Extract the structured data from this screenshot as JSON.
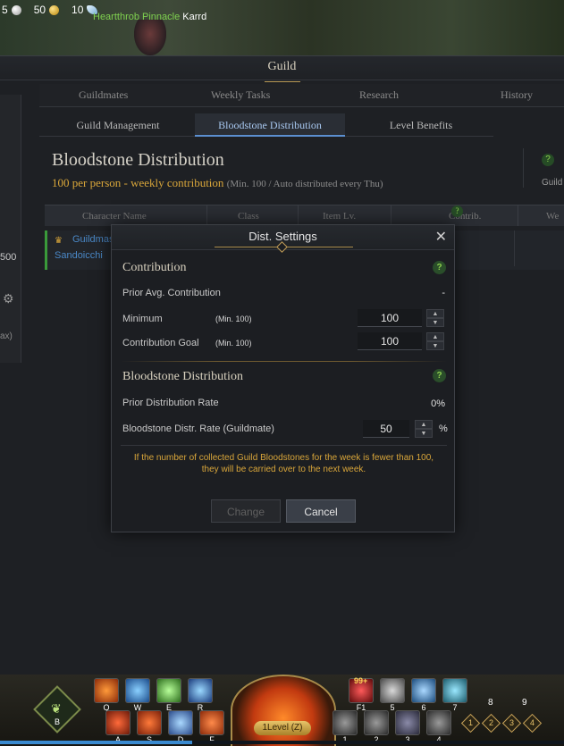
{
  "hud": {
    "silver": "5",
    "gold": "50",
    "crystal": "10",
    "zone": "Heartthrob Pinnacle",
    "player": "Karrd"
  },
  "guild": {
    "title": "Guild",
    "tabs": [
      "Guildmates",
      "Weekly Tasks",
      "Research",
      "History"
    ],
    "subtabs": [
      "Guild Management",
      "Bloodstone Distribution",
      "Level Benefits"
    ],
    "active_subtab": "Bloodstone Distribution",
    "heading": "Bloodstone Distribution",
    "subheading": "100 per person - weekly contribution",
    "subheading_note": "(Min. 100 / Auto distributed every Thu)",
    "right_frag_text": "Guild",
    "left_value": "500",
    "left_frag": "ax)",
    "columns": [
      "Character Name",
      "Class",
      "Item Lv.",
      "Contrib. Lv.",
      "We"
    ],
    "member": {
      "role": "Guildmas",
      "name": "Sandoicchi"
    }
  },
  "dialog": {
    "title": "Dist. Settings",
    "contribution": {
      "title": "Contribution",
      "prior_avg_label": "Prior Avg. Contribution",
      "prior_avg_value": "-",
      "minimum_label": "Minimum",
      "minimum_hint": "(Min. 100)",
      "minimum_value": "100",
      "goal_label": "Contribution Goal",
      "goal_hint": "(Min. 100)",
      "goal_value": "100"
    },
    "distribution": {
      "title": "Bloodstone Distribution",
      "prior_rate_label": "Prior Distribution Rate",
      "prior_rate_value": "0%",
      "rate_label": "Bloodstone Distr. Rate (Guildmate)",
      "rate_value": "50",
      "rate_unit": "%"
    },
    "warning_line1": "If the number of collected Guild Bloodstones for the week is fewer than 100,",
    "warning_line2": "they will be carried over to the next week.",
    "change_label": "Change",
    "cancel_label": "Cancel"
  },
  "hotbar": {
    "minimap_key": "B",
    "skills_top": [
      "Q",
      "W",
      "E",
      "R"
    ],
    "skills_bottom": [
      "A",
      "S",
      "D",
      "F"
    ],
    "level_label": "1Level (Z)",
    "items_top": [
      "F1",
      "5",
      "6",
      "7"
    ],
    "items_bottom": [
      "1",
      "2",
      "3",
      "4"
    ],
    "extra_keys": [
      "8",
      "9"
    ],
    "item_count": "99+",
    "diamonds": [
      "1",
      "2",
      "3",
      "4"
    ],
    "xp_fraction": 0.34
  },
  "colors": {
    "accent_gold": "#d9a63a",
    "help_green": "#8fd14f",
    "link_blue": "#4a88c7"
  }
}
